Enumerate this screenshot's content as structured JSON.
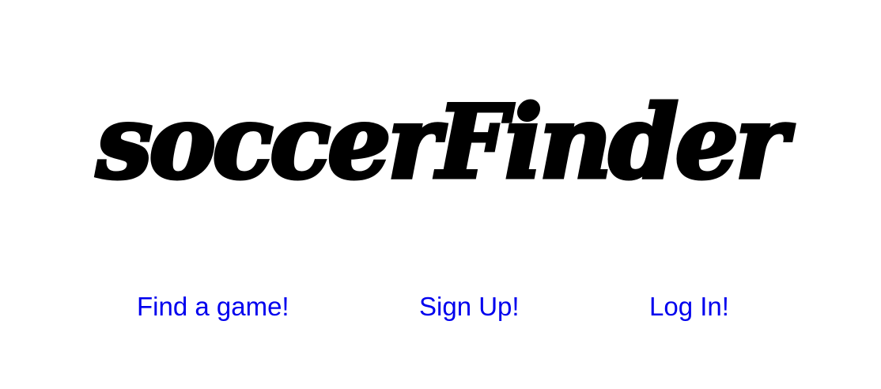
{
  "brand": {
    "logo_text": "soccerFinder"
  },
  "nav": {
    "links": [
      {
        "label": "Find a game!"
      },
      {
        "label": "Sign Up!"
      },
      {
        "label": "Log In!"
      }
    ],
    "link_color": "#0000EE"
  },
  "colors": {
    "background": "#FFFFFF",
    "logo": "#000000"
  }
}
